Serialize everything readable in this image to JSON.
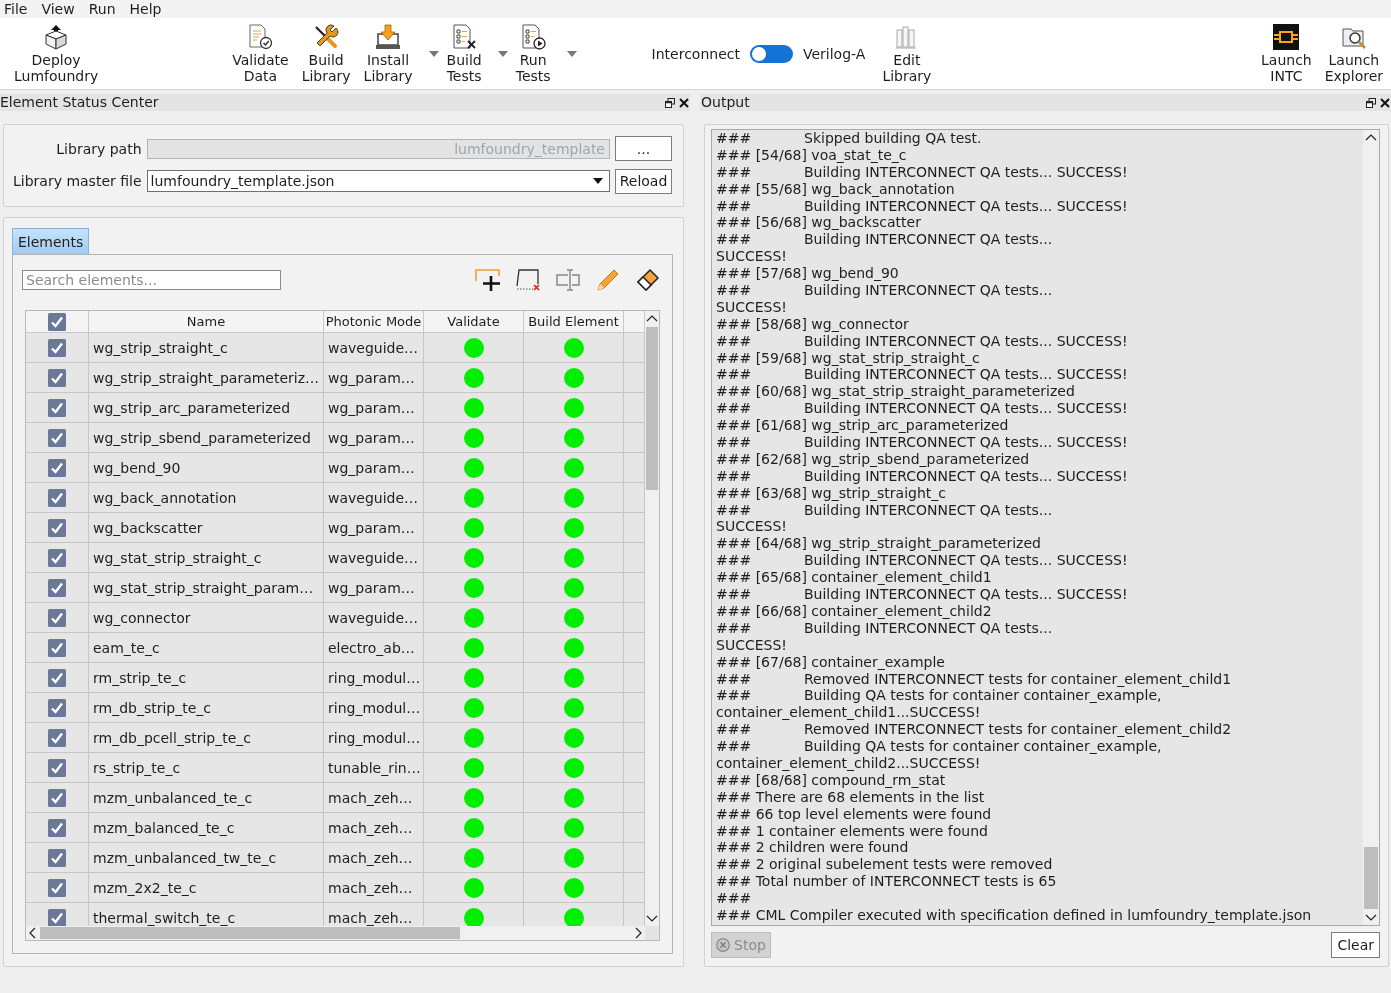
{
  "menu": [
    "File",
    "View",
    "Run",
    "Help"
  ],
  "toolbar": {
    "primary": [
      {
        "label": "Deploy Lumfoundry",
        "has_menu": false
      }
    ],
    "actions": [
      {
        "label": "Validate Data",
        "has_menu": false
      },
      {
        "label": "Build Library",
        "has_menu": false
      },
      {
        "label": "Install Library",
        "has_menu": true
      },
      {
        "label": "Build Tests",
        "has_menu": true
      },
      {
        "label": "Run Tests",
        "has_menu": true
      }
    ],
    "mode_switch": {
      "left_label": "Interconnect",
      "right_label": "Verilog-A",
      "on": false
    },
    "editing": [
      {
        "label": "Edit Library",
        "has_menu": false
      }
    ],
    "launchers": [
      {
        "label": "Launch INTC",
        "has_menu": false
      },
      {
        "label": "Launch Explorer",
        "has_menu": false
      }
    ]
  },
  "element_status_center": {
    "title": "Element Status Center",
    "library_path": {
      "label": "Library path",
      "value": "lumfoundry_template",
      "disabled": true,
      "browse_button": "..."
    },
    "library_master_file": {
      "label": "Library master file",
      "value": "lumfoundry_template.json",
      "reload_button": "Reload"
    },
    "tabs": [
      {
        "label": "Elements",
        "selected": true
      }
    ],
    "search": {
      "placeholder": "Search elements..."
    },
    "table": {
      "header_checked": true,
      "columns": [
        "Name",
        "Photonic Mode",
        "Validate",
        "Build Element"
      ],
      "rows": [
        {
          "checked": true,
          "name": "wg_strip_straight_c",
          "photonic_model": "waveguide…",
          "validated": true,
          "built": true
        },
        {
          "checked": true,
          "name": "wg_strip_straight_parameteriz…",
          "photonic_model": "wg_param…",
          "validated": true,
          "built": true
        },
        {
          "checked": true,
          "name": "wg_strip_arc_parameterized",
          "photonic_model": "wg_param…",
          "validated": true,
          "built": true
        },
        {
          "checked": true,
          "name": "wg_strip_sbend_parameterized",
          "photonic_model": "wg_param…",
          "validated": true,
          "built": true
        },
        {
          "checked": true,
          "name": "wg_bend_90",
          "photonic_model": "wg_param…",
          "validated": true,
          "built": true
        },
        {
          "checked": true,
          "name": "wg_back_annotation",
          "photonic_model": "waveguide…",
          "validated": true,
          "built": true
        },
        {
          "checked": true,
          "name": "wg_backscatter",
          "photonic_model": "wg_param…",
          "validated": true,
          "built": true
        },
        {
          "checked": true,
          "name": "wg_stat_strip_straight_c",
          "photonic_model": "waveguide…",
          "validated": true,
          "built": true
        },
        {
          "checked": true,
          "name": "wg_stat_strip_straight_param…",
          "photonic_model": "wg_param…",
          "validated": true,
          "built": true
        },
        {
          "checked": true,
          "name": "wg_connector",
          "photonic_model": "waveguide…",
          "validated": true,
          "built": true
        },
        {
          "checked": true,
          "name": "eam_te_c",
          "photonic_model": "electro_ab…",
          "validated": true,
          "built": true
        },
        {
          "checked": true,
          "name": "rm_strip_te_c",
          "photonic_model": "ring_modul…",
          "validated": true,
          "built": true
        },
        {
          "checked": true,
          "name": "rm_db_strip_te_c",
          "photonic_model": "ring_modul…",
          "validated": true,
          "built": true
        },
        {
          "checked": true,
          "name": "rm_db_pcell_strip_te_c",
          "photonic_model": "ring_modul…",
          "validated": true,
          "built": true
        },
        {
          "checked": true,
          "name": "rs_strip_te_c",
          "photonic_model": "tunable_rin…",
          "validated": true,
          "built": true
        },
        {
          "checked": true,
          "name": "mzm_unbalanced_te_c",
          "photonic_model": "mach_zeh…",
          "validated": true,
          "built": true
        },
        {
          "checked": true,
          "name": "mzm_balanced_te_c",
          "photonic_model": "mach_zeh…",
          "validated": true,
          "built": true
        },
        {
          "checked": true,
          "name": "mzm_unbalanced_tw_te_c",
          "photonic_model": "mach_zeh…",
          "validated": true,
          "built": true
        },
        {
          "checked": true,
          "name": "mzm_2x2_te_c",
          "photonic_model": "mach_zeh…",
          "validated": true,
          "built": true
        },
        {
          "checked": true,
          "name": "thermal_switch_te_c",
          "photonic_model": "mach_zeh…",
          "validated": true,
          "built": true
        }
      ]
    }
  },
  "output": {
    "title": "Output",
    "lines": [
      "###\tSkipped building QA test.",
      "### [54/68] voa_stat_te_c",
      "###\tBuilding INTERCONNECT QA tests... SUCCESS!",
      "### [55/68] wg_back_annotation",
      "###\tBuilding INTERCONNECT QA tests... SUCCESS!",
      "### [56/68] wg_backscatter",
      "###\tBuilding INTERCONNECT QA tests...",
      "SUCCESS!",
      "### [57/68] wg_bend_90",
      "###\tBuilding INTERCONNECT QA tests...",
      "SUCCESS!",
      "### [58/68] wg_connector",
      "###\tBuilding INTERCONNECT QA tests... SUCCESS!",
      "### [59/68] wg_stat_strip_straight_c",
      "###\tBuilding INTERCONNECT QA tests... SUCCESS!",
      "### [60/68] wg_stat_strip_straight_parameterized",
      "###\tBuilding INTERCONNECT QA tests... SUCCESS!",
      "### [61/68] wg_strip_arc_parameterized",
      "###\tBuilding INTERCONNECT QA tests... SUCCESS!",
      "### [62/68] wg_strip_sbend_parameterized",
      "###\tBuilding INTERCONNECT QA tests... SUCCESS!",
      "### [63/68] wg_strip_straight_c",
      "###\tBuilding INTERCONNECT QA tests...",
      "SUCCESS!",
      "### [64/68] wg_strip_straight_parameterized",
      "###\tBuilding INTERCONNECT QA tests... SUCCESS!",
      "### [65/68] container_element_child1",
      "###\tBuilding INTERCONNECT QA tests... SUCCESS!",
      "### [66/68] container_element_child2",
      "###\tBuilding INTERCONNECT QA tests...",
      "SUCCESS!",
      "### [67/68] container_example",
      "###\tRemoved INTERCONNECT tests for container_element_child1",
      "###\tBuilding QA tests for container container_example,",
      "container_element_child1...SUCCESS!",
      "###\tRemoved INTERCONNECT tests for container_element_child2",
      "###\tBuilding QA tests for container container_example,",
      "container_element_child2...SUCCESS!",
      "### [68/68] compound_rm_stat",
      "### There are 68 elements in the list",
      "### 66 top level elements were found",
      "### 1 container elements were found",
      "### 2 children were found",
      "### 2 original subelement tests were removed",
      "### Total number of INTERCONNECT tests is 65",
      "###",
      "### CML Compiler executed with specification defined in lumfoundry_template.json"
    ],
    "stop_button": {
      "label": "Stop",
      "disabled": true
    },
    "clear_button": "Clear"
  }
}
